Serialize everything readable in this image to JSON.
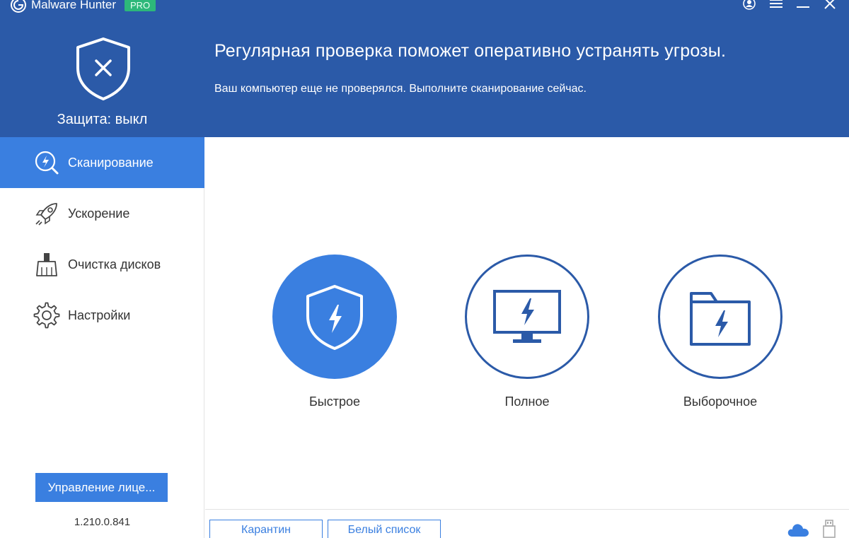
{
  "app": {
    "title": "Malware Hunter",
    "badge": "PRO"
  },
  "window_controls": [
    "user-icon",
    "menu-icon",
    "minimize-icon",
    "close-icon"
  ],
  "header": {
    "protection_status": "Защита: выкл",
    "headline": "Регулярная проверка поможет оперативно устранять угрозы.",
    "subline": "Ваш компьютер еще не проверялся. Выполните сканирование сейчас."
  },
  "sidebar": {
    "items": [
      {
        "label": "Сканирование",
        "icon": "scan-icon",
        "active": true
      },
      {
        "label": "Ускорение",
        "icon": "rocket-icon",
        "active": false
      },
      {
        "label": "Очистка дисков",
        "icon": "broom-icon",
        "active": false
      },
      {
        "label": "Настройки",
        "icon": "gear-icon",
        "active": false
      }
    ],
    "license_button": "Управление лице...",
    "version": "1.210.0.841"
  },
  "scan_options": [
    {
      "label": "Быстрое",
      "icon": "shield-lightning-icon",
      "selected": true
    },
    {
      "label": "Полное",
      "icon": "monitor-lightning-icon",
      "selected": false
    },
    {
      "label": "Выборочное",
      "icon": "folder-lightning-icon",
      "selected": false
    }
  ],
  "bottom_bar": {
    "quarantine": "Карантин",
    "whitelist": "Белый список"
  },
  "colors": {
    "header_bg": "#2b5aa8",
    "accent": "#3a7fe0",
    "badge": "#2db87a"
  }
}
